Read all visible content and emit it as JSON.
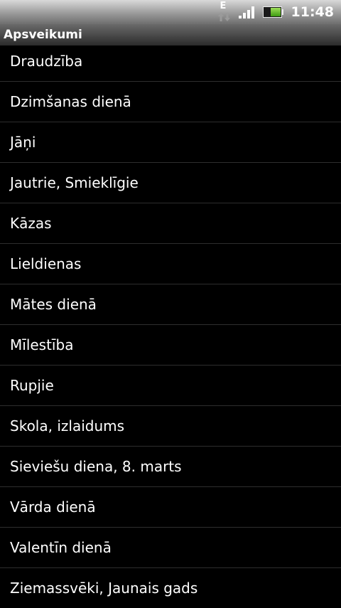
{
  "status_bar": {
    "network_type": "E",
    "time": "11:48",
    "battery_level": 0.6,
    "signal_bars": 4,
    "icons": [
      "network-activity-icon",
      "signal-strength-icon",
      "battery-icon"
    ]
  },
  "title_bar": {
    "title": "Apsveikumi"
  },
  "list": {
    "items": [
      {
        "label": "Draudzība"
      },
      {
        "label": "Dzimšanas dienā"
      },
      {
        "label": "Jāņi"
      },
      {
        "label": "Jautrie, Smieklīgie"
      },
      {
        "label": "Kāzas"
      },
      {
        "label": "Lieldienas"
      },
      {
        "label": "Mātes dienā"
      },
      {
        "label": "Mīlestība"
      },
      {
        "label": "Rupjie"
      },
      {
        "label": "Skola, izlaidums"
      },
      {
        "label": "Sieviešu diena, 8. marts"
      },
      {
        "label": "Vārda dienā"
      },
      {
        "label": "Valentīn dienā"
      },
      {
        "label": "Ziemassvēki, Jaunais gads"
      }
    ]
  },
  "colors": {
    "background": "#000000",
    "text": "#ffffff",
    "divider": "#2e2e2e",
    "battery_fill": "#5cc21a"
  }
}
